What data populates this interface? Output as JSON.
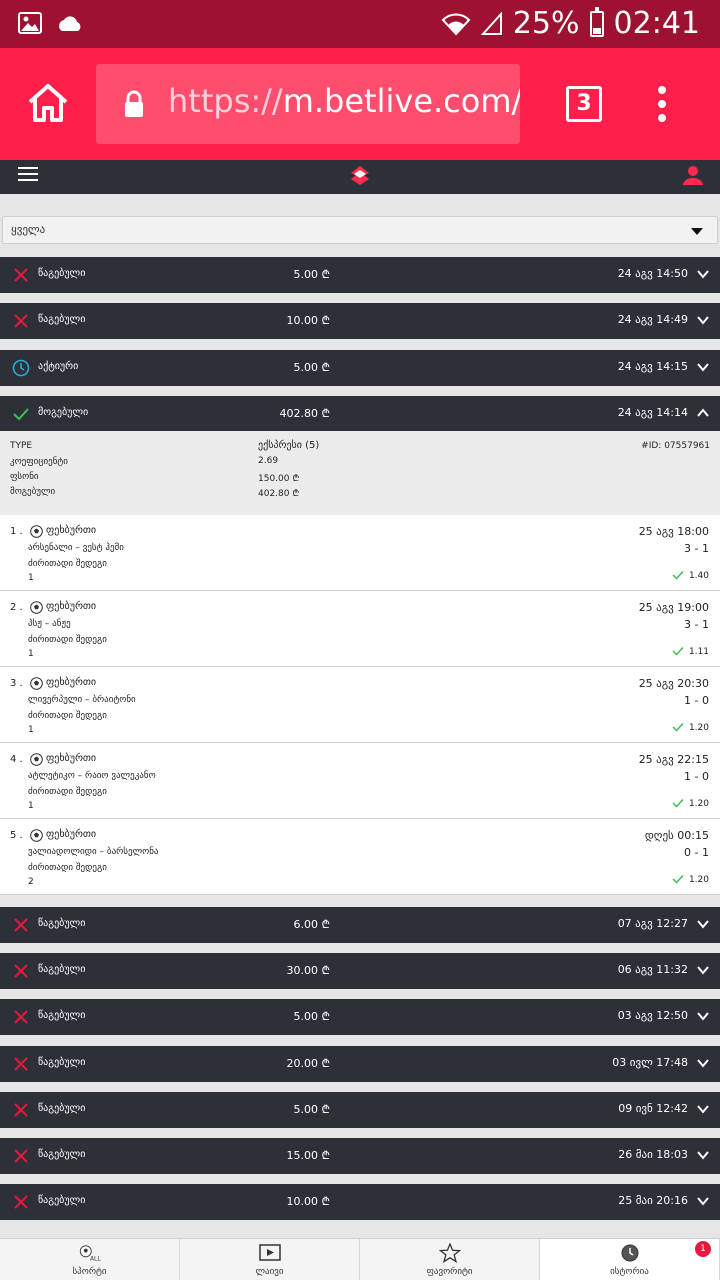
{
  "status_bar": {
    "battery": "25%",
    "time": "02:41"
  },
  "browser": {
    "url_proto": "https://",
    "url_rest": "m.betlive.com/k",
    "tab_count": "3"
  },
  "filter": {
    "selected": "ყველა"
  },
  "bets": [
    {
      "status": "წაგებული",
      "state": "lost",
      "amount": "5.00 ₾",
      "date": "24 აგვ 14:50",
      "expanded": false
    },
    {
      "status": "წაგებული",
      "state": "lost",
      "amount": "10.00 ₾",
      "date": "24 აგვ 14:49",
      "expanded": false
    },
    {
      "status": "აქტიური",
      "state": "active",
      "amount": "5.00 ₾",
      "date": "24 აგვ 14:15",
      "expanded": false
    },
    {
      "status": "მოგებული",
      "state": "won",
      "amount": "402.80 ₾",
      "date": "24 აგვ 14:14",
      "expanded": true
    }
  ],
  "details": {
    "type_label": "TYPE",
    "type_value": "ექსპრესი (5)",
    "id": "#ID: 07557961",
    "coef_label": "კოეფიციენტი",
    "coef_value": "2.69",
    "stake_label": "ფსონი",
    "stake_value": "150.00 ₾",
    "win_label": "მოგებული",
    "win_value": "402.80 ₾"
  },
  "events": [
    {
      "num": "1 .",
      "sport": "ფეხბურთი",
      "match": "არსენალი – ვესტ ჰემი",
      "market": "ძირითადი შედეგი",
      "pick": "1",
      "date": "25 აგვ 18:00",
      "score": "3 - 1",
      "odd": "1.40"
    },
    {
      "num": "2 .",
      "sport": "ფეხბურთი",
      "match": "პსჟ – ანჟე",
      "market": "ძირითადი შედეგი",
      "pick": "1",
      "date": "25 აგვ 19:00",
      "score": "3 - 1",
      "odd": "1.11"
    },
    {
      "num": "3 .",
      "sport": "ფეხბურთი",
      "match": "ლივერპული – ბრაიტონი",
      "market": "ძირითადი შედეგი",
      "pick": "1",
      "date": "25 აგვ 20:30",
      "score": "1 - 0",
      "odd": "1.20"
    },
    {
      "num": "4 .",
      "sport": "ფეხბურთი",
      "match": "ატლეტიკო – რაიო ვალეკანო",
      "market": "ძირითადი შედეგი",
      "pick": "1",
      "date": "25 აგვ 22:15",
      "score": "1 - 0",
      "odd": "1.20"
    },
    {
      "num": "5 .",
      "sport": "ფეხბურთი",
      "match": "ვალიადოლიდი – ბარსელონა",
      "market": "ძირითადი შედეგი",
      "pick": "2",
      "date": "დღეს 00:15",
      "score": "0 - 1",
      "odd": "1.20"
    }
  ],
  "bets_after": [
    {
      "status": "წაგებული",
      "state": "lost",
      "amount": "6.00 ₾",
      "date": "07 აგვ 12:27"
    },
    {
      "status": "წაგებული",
      "state": "lost",
      "amount": "30.00 ₾",
      "date": "06 აგვ 11:32"
    },
    {
      "status": "წაგებული",
      "state": "lost",
      "amount": "5.00 ₾",
      "date": "03 აგვ 12:50"
    },
    {
      "status": "წაგებული",
      "state": "lost",
      "amount": "20.00 ₾",
      "date": "03 ივლ 17:48"
    },
    {
      "status": "წაგებული",
      "state": "lost",
      "amount": "5.00 ₾",
      "date": "09 ივნ 12:42"
    },
    {
      "status": "წაგებული",
      "state": "lost",
      "amount": "15.00 ₾",
      "date": "26 მაი 18:03"
    },
    {
      "status": "წაგებული",
      "state": "lost",
      "amount": "10.00 ₾",
      "date": "25 მაი 20:16"
    }
  ],
  "nav": [
    {
      "label": "სპორტი",
      "icon": "sports-all-icon",
      "badge_text": "ALL"
    },
    {
      "label": "ლაივი",
      "icon": "live-play-icon"
    },
    {
      "label": "ფავორიტი",
      "icon": "star-icon"
    },
    {
      "label": "ისტორია",
      "icon": "history-clock-icon",
      "badge": "1",
      "active": true
    }
  ],
  "colors": {
    "status_bar": "#9c1230",
    "browser_bar": "#ff1f4b",
    "app_bar": "#2e3038",
    "lost": "#e8173f",
    "won": "#3fbf5a",
    "active": "#29a8e0"
  }
}
